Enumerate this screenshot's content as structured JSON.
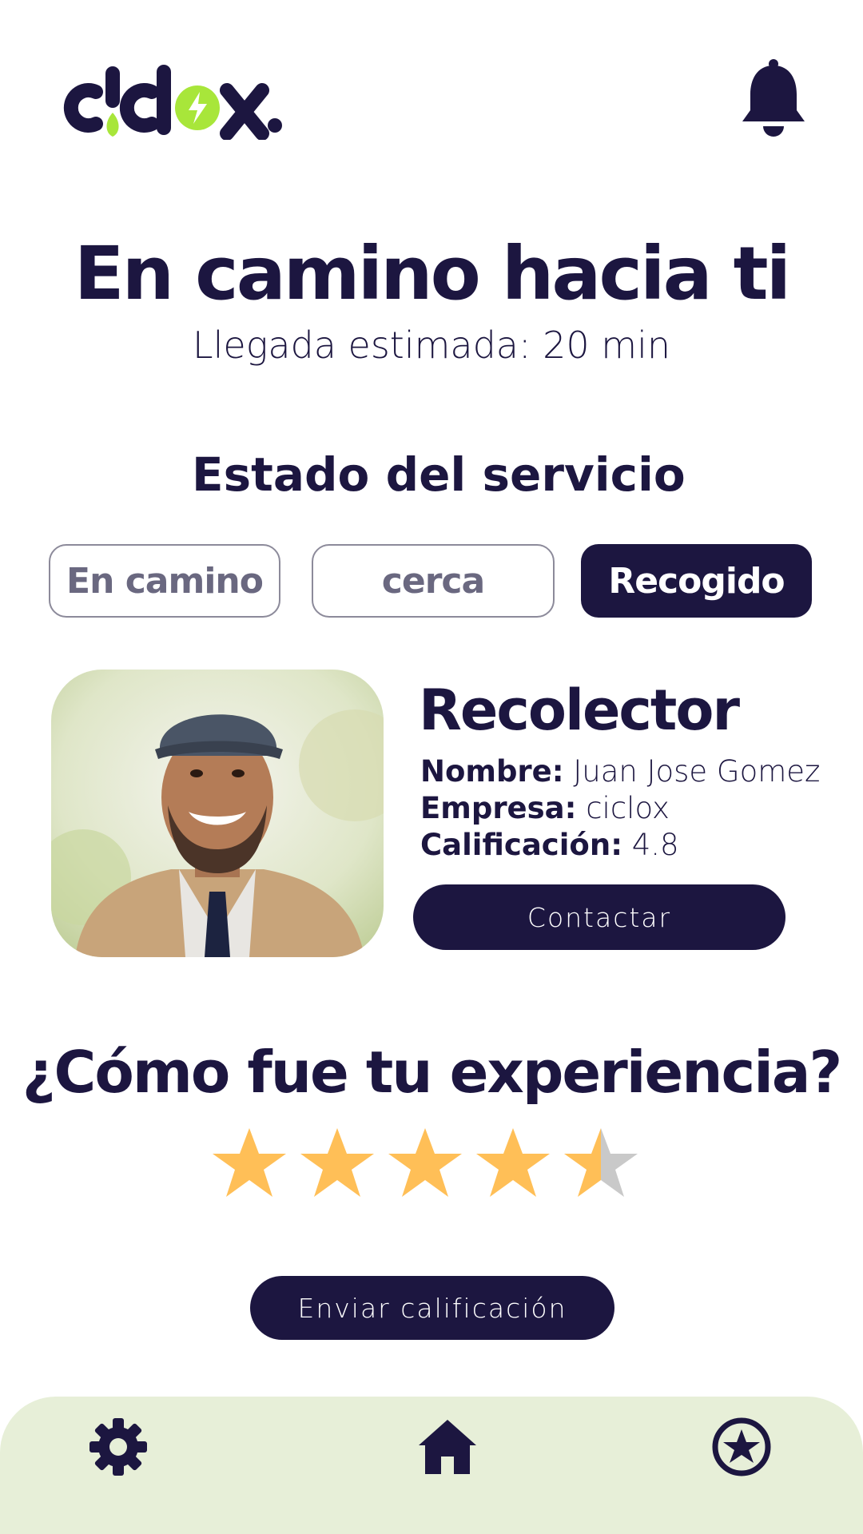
{
  "header": {
    "logo_text": "ciclox",
    "bell_icon": "bell-icon"
  },
  "hero": {
    "title": "En camino hacia ti",
    "subtitle": "Llegada estimada: 20 min"
  },
  "status": {
    "heading": "Estado del servicio",
    "steps": [
      {
        "label": "En camino",
        "active": false
      },
      {
        "label": "cerca",
        "active": false
      },
      {
        "label": "Recogido",
        "active": true
      }
    ]
  },
  "collector": {
    "heading": "Recolector",
    "name_label": "Nombre:",
    "name_value": "Juan Jose Gomez",
    "company_label": "Empresa:",
    "company_value": "ciclox",
    "rating_label": "Calificación:",
    "rating_value": "4.8",
    "contact_label": "Contactar"
  },
  "feedback": {
    "question": "¿Cómo fue tu experiencia?",
    "rating": 4.5,
    "max_rating": 5,
    "send_label": "Enviar calificación"
  },
  "nav": {
    "items": [
      {
        "icon": "gear-icon"
      },
      {
        "icon": "home-icon"
      },
      {
        "icon": "star-badge-icon"
      }
    ]
  },
  "colors": {
    "primary": "#1c1640",
    "accent_green": "#a8e63a",
    "star": "#ffbf57",
    "star_empty": "#c9c9c9",
    "nav_bg": "#e7efd8"
  }
}
